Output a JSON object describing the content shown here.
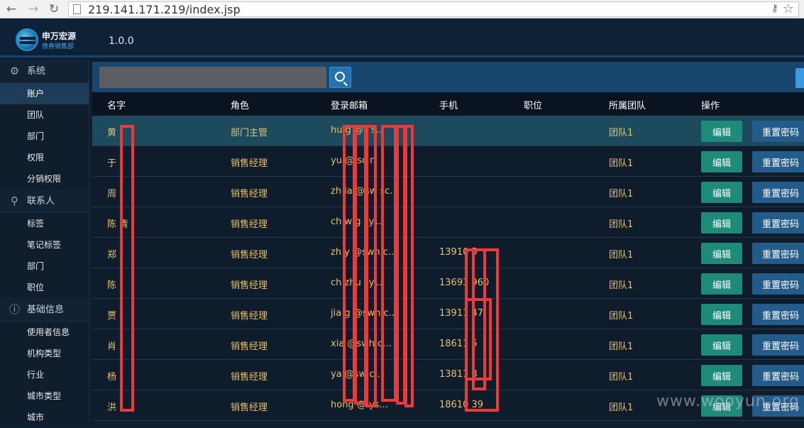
{
  "browser": {
    "url": "219.141.171.219/index.jsp",
    "back_icon": "arrow-left-icon",
    "forward_icon": "arrow-right-icon",
    "reload_icon": "reload-icon"
  },
  "header": {
    "logo_title": "申万宏源",
    "logo_subtitle": "债券销售部",
    "version": "1.0.0"
  },
  "sidebar": {
    "groups": [
      {
        "label": "系统",
        "icon": "gear-icon",
        "items": [
          "账户",
          "团队",
          "部门",
          "权限",
          "分销权限"
        ],
        "active_index": 0
      },
      {
        "label": "联系人",
        "icon": "user-icon",
        "items": [
          "标签",
          "笔记标签",
          "部门",
          "职位"
        ]
      },
      {
        "label": "基础信息",
        "icon": "info-icon",
        "items": [
          "使用者信息",
          "机构类型",
          "行业",
          "城市类型",
          "城市"
        ]
      }
    ]
  },
  "search": {
    "placeholder": "",
    "button_icon": "search-icon"
  },
  "table": {
    "columns": [
      "名字",
      "角色",
      "登录邮箱",
      "手机",
      "职位",
      "所属团队",
      "操作"
    ],
    "edit_label": "编辑",
    "reset_label": "重置密码",
    "rows": [
      {
        "name": "黄",
        "role": "部门主管",
        "email": "hu   g   @s   s...",
        "phone": "",
        "team": "团队1"
      },
      {
        "name": "于",
        "role": "销售经理",
        "email": "yu   @   sc   n",
        "phone": "",
        "team": "团队1"
      },
      {
        "name": "周",
        "role": "销售经理",
        "email": "zh   ia   @sw   sc...",
        "phone": "",
        "team": "团队1"
      },
      {
        "name": "陈   青",
        "role": "销售经理",
        "email": "ch   w   g   sy...",
        "phone": "",
        "team": "团队1"
      },
      {
        "name": "郑",
        "role": "销售经理",
        "email": "zh   y   @swh   c...",
        "phone": "13910   5",
        "team": "团队1"
      },
      {
        "name": "陈",
        "role": "销售经理",
        "email": "ch   zhu   sy...",
        "phone": "13693   960",
        "team": "团队1"
      },
      {
        "name": "贾",
        "role": "销售经理",
        "email": "jia   g   @swh   c...",
        "phone": "13911   47",
        "team": "团队1"
      },
      {
        "name": "肖",
        "role": "销售经理",
        "email": "xia   @swh   c...",
        "phone": "18611   5",
        "team": "团队1"
      },
      {
        "name": "杨",
        "role": "销售经理",
        "email": "ya   @sw   c...",
        "phone": "13811   3",
        "team": "团队1"
      },
      {
        "name": "洪",
        "role": "销售经理",
        "email": "hong   @   ys...",
        "phone": "18610   39",
        "team": "团队1"
      }
    ]
  },
  "watermark": "www.wooyun.org",
  "colors": {
    "header_bg": "#0d2137",
    "toolbar_bg": "#18466e",
    "cell_text": "#e7c067",
    "edit_button": "#1d8a7a",
    "reset_button": "#235c8a",
    "redaction": "#f03838"
  }
}
